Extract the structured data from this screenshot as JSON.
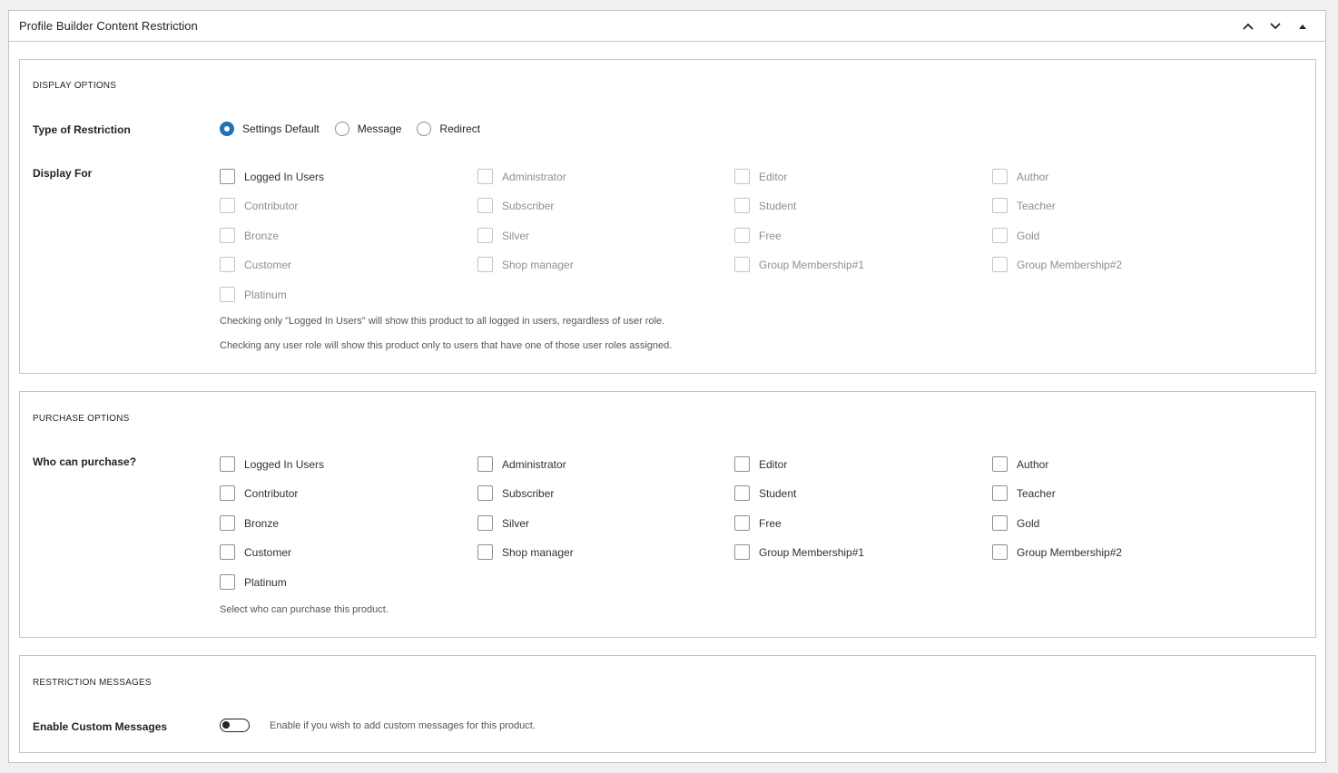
{
  "metabox": {
    "title": "Profile Builder Content Restriction",
    "icons": [
      "chevron-up-icon",
      "chevron-down-icon",
      "triangle-up-icon"
    ]
  },
  "display_options": {
    "section_title": "DISPLAY OPTIONS",
    "restriction_label": "Type of Restriction",
    "restriction_types": [
      {
        "label": "Settings Default",
        "checked": true
      },
      {
        "label": "Message",
        "checked": false
      },
      {
        "label": "Redirect",
        "checked": false
      }
    ],
    "display_for_label": "Display For",
    "roles": [
      {
        "label": "Logged In Users",
        "enabled": true
      },
      {
        "label": "Administrator",
        "enabled": false
      },
      {
        "label": "Editor",
        "enabled": false
      },
      {
        "label": "Author",
        "enabled": false
      },
      {
        "label": "Contributor",
        "enabled": false
      },
      {
        "label": "Subscriber",
        "enabled": false
      },
      {
        "label": "Student",
        "enabled": false
      },
      {
        "label": "Teacher",
        "enabled": false
      },
      {
        "label": "Bronze",
        "enabled": false
      },
      {
        "label": "Silver",
        "enabled": false
      },
      {
        "label": "Free",
        "enabled": false
      },
      {
        "label": "Gold",
        "enabled": false
      },
      {
        "label": "Customer",
        "enabled": false
      },
      {
        "label": "Shop manager",
        "enabled": false
      },
      {
        "label": "Group Membership#1",
        "enabled": false
      },
      {
        "label": "Group Membership#2",
        "enabled": false
      },
      {
        "label": "Platinum",
        "enabled": false
      }
    ],
    "help_1": "Checking only \"Logged In Users\" will show this product to all logged in users, regardless of user role.",
    "help_2": "Checking any user role will show this product only to users that have one of those user roles assigned."
  },
  "purchase_options": {
    "section_title": "PURCHASE OPTIONS",
    "who_label": "Who can purchase?",
    "roles": [
      "Logged In Users",
      "Administrator",
      "Editor",
      "Author",
      "Contributor",
      "Subscriber",
      "Student",
      "Teacher",
      "Bronze",
      "Silver",
      "Free",
      "Gold",
      "Customer",
      "Shop manager",
      "Group Membership#1",
      "Group Membership#2",
      "Platinum"
    ],
    "help": "Select who can purchase this product."
  },
  "restriction_messages": {
    "section_title": "RESTRICTION MESSAGES",
    "custom_label": "Enable Custom Messages",
    "toggle_on": false,
    "toggle_help": "Enable if you wish to add custom messages for this product."
  },
  "colors": {
    "accent": "#2271b1",
    "border": "#c3c4c7",
    "disabled_text": "#8c8f94"
  }
}
